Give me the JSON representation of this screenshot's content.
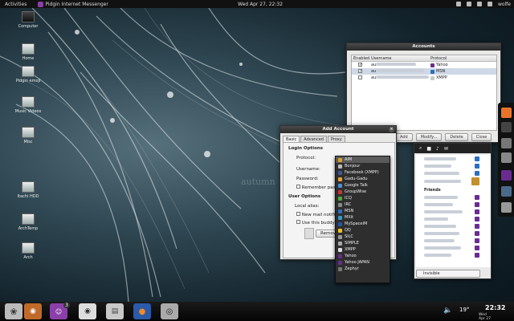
{
  "topbar": {
    "activities": "Activities",
    "app_name": "Pidgin Internet Messenger",
    "clock": "Wed Apr 27, 22:32",
    "user": "wolfe"
  },
  "desktop_icons": [
    {
      "label": "Computer"
    },
    {
      "label": "Home"
    },
    {
      "label": "Pidgin emoji"
    },
    {
      "label": "Music Videos"
    },
    {
      "label": "Misc"
    },
    {
      "label": "Itachi HDD"
    },
    {
      "label": "ArchTemp"
    },
    {
      "label": "Arch"
    }
  ],
  "wallpaper_watermark": "autumn",
  "accounts_window": {
    "title": "Accounts",
    "columns": [
      "Enabled",
      "Username",
      "Protocol"
    ],
    "rows": [
      {
        "enabled": true,
        "prefix": "au",
        "protocol": "Yahoo",
        "color": "#6a2c91"
      },
      {
        "enabled": true,
        "prefix": "au",
        "protocol": "MSN",
        "color": "#2a6fbf"
      },
      {
        "enabled": false,
        "prefix": "au",
        "protocol": "XMPP",
        "color": "#c8c8c8"
      }
    ],
    "buttons": {
      "add": "Add",
      "modify": "Modify...",
      "delete": "Delete",
      "close": "Close"
    }
  },
  "add_account": {
    "title": "Add Account",
    "tabs": [
      "Basic",
      "Advanced",
      "Proxy"
    ],
    "login_options": "Login Options",
    "protocol_label": "Protocol:",
    "username_label": "Username:",
    "password_label": "Password:",
    "remember_label": "Remember passw",
    "user_options": "User Options",
    "local_alias_label": "Local alias:",
    "new_mail_label": "New mail notificat",
    "use_buddy_label": "Use this buddy ic",
    "remove_label": "Remov"
  },
  "protocols": [
    {
      "name": "AIM",
      "color": "#e0a020",
      "selected": true
    },
    {
      "name": "Bonjour",
      "color": "#bbbbbb"
    },
    {
      "name": "Facebook (XMPP)",
      "color": "#3b5998"
    },
    {
      "name": "Gadu-Gadu",
      "color": "#e8a030"
    },
    {
      "name": "Google Talk",
      "color": "#4a90d9"
    },
    {
      "name": "GroupWise",
      "color": "#cc3333"
    },
    {
      "name": "ICQ",
      "color": "#55aa33"
    },
    {
      "name": "IRC",
      "color": "#888888"
    },
    {
      "name": "MSN",
      "color": "#2a6fbf"
    },
    {
      "name": "MXit",
      "color": "#3399cc"
    },
    {
      "name": "MySpaceIM",
      "color": "#2255aa"
    },
    {
      "name": "QQ",
      "color": "#f0c020"
    },
    {
      "name": "SILC",
      "color": "#999999"
    },
    {
      "name": "SIMPLE",
      "color": "#aaaaaa"
    },
    {
      "name": "XMPP",
      "color": "#dddddd"
    },
    {
      "name": "Yahoo",
      "color": "#6a2c91"
    },
    {
      "name": "Yahoo JAPAN",
      "color": "#6a2c91"
    },
    {
      "name": "Zephyr",
      "color": "#777777"
    }
  ],
  "buddy_list": {
    "group_label": "Friends",
    "status": "Invisible"
  },
  "dock": {
    "badge_count": "3",
    "time": "22:32",
    "date_line1": "Wed",
    "date_line2": "Apr 27",
    "weather": "19°"
  }
}
